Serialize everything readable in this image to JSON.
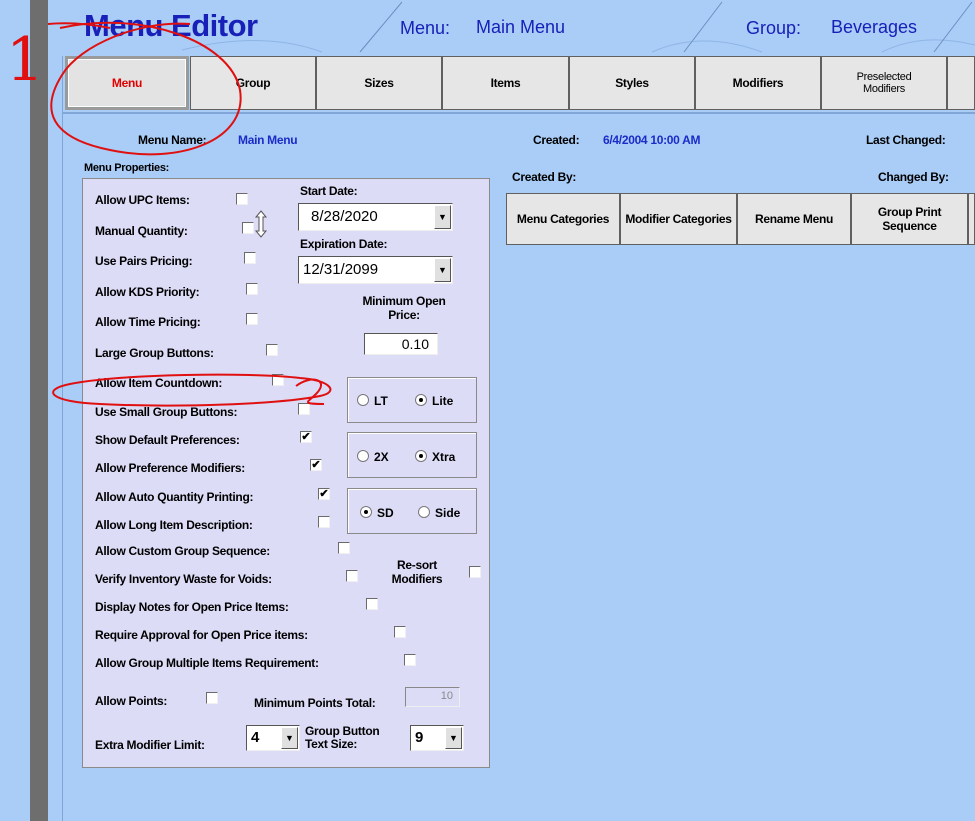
{
  "header": {
    "title": "Menu Editor",
    "menu_label": "Menu:",
    "menu_value": "Main Menu",
    "group_label": "Group:",
    "group_value": "Beverages"
  },
  "tabs": [
    {
      "label": "Menu",
      "active": true
    },
    {
      "label": "Group"
    },
    {
      "label": "Sizes"
    },
    {
      "label": "Items"
    },
    {
      "label": "Styles"
    },
    {
      "label": "Modifiers"
    },
    {
      "label": "Preselected Modifiers"
    }
  ],
  "info": {
    "menu_name_label": "Menu Name:",
    "menu_name_value": "Main Menu",
    "created_label": "Created:",
    "created_value": "6/4/2004 10:00 AM",
    "last_changed_label": "Last Changed:",
    "created_by_label": "Created By:",
    "changed_by_label": "Changed By:",
    "properties_label": "Menu Properties:"
  },
  "props": {
    "allow_upc": "Allow UPC Items:",
    "manual_qty": "Manual Quantity:",
    "pairs_pricing": "Use Pairs Pricing:",
    "kds_priority": "Allow KDS Priority:",
    "time_pricing": "Allow Time Pricing:",
    "large_group": "Large Group Buttons:",
    "item_countdown": "Allow Item Countdown:",
    "small_group": "Use Small Group Buttons:",
    "default_prefs": "Show Default Preferences:",
    "pref_modifiers": "Allow Preference Modifiers:",
    "auto_qty": "Allow Auto Quantity Printing:",
    "long_desc": "Allow Long Item Description:",
    "custom_seq": "Allow Custom Group Sequence:",
    "verify_waste": "Verify Inventory Waste for Voids:",
    "resort_mods": "Re-sort Modifiers",
    "display_notes": "Display Notes for Open Price Items:",
    "require_approval": "Require Approval for Open Price items:",
    "group_multi": "Allow Group Multiple Items Requirement:",
    "allow_points": "Allow Points:",
    "min_points_label": "Minimum Points Total:",
    "min_points_value": "10",
    "extra_mod_label": "Extra Modifier Limit:",
    "extra_mod_value": "4",
    "group_btn_text_label": "Group Button Text Size:",
    "group_btn_text_value": "9",
    "start_date_label": "Start Date:",
    "start_date_value": "8/28/2020",
    "exp_date_label": "Expiration Date:",
    "exp_date_value": "12/31/2099",
    "min_open_label": "Minimum Open Price:",
    "min_open_value": "0.10",
    "radio_lt": "LT",
    "radio_lite": "Lite",
    "radio_2x": "2X",
    "radio_xtra": "Xtra",
    "radio_sd": "SD",
    "radio_side": "Side"
  },
  "buttons": {
    "menu_categories": "Menu Categories",
    "modifier_categories": "Modifier Categories",
    "rename_menu": "Rename Menu",
    "group_print_seq": "Group Print Sequence"
  },
  "annotations": {
    "one": "1",
    "two": "2"
  },
  "colors": {
    "background": "#a9cdf7",
    "title_blue": "#1820b8",
    "active_tab_red": "#e00000",
    "annotation_red": "#e01010",
    "panel": "#dcdcf7"
  }
}
